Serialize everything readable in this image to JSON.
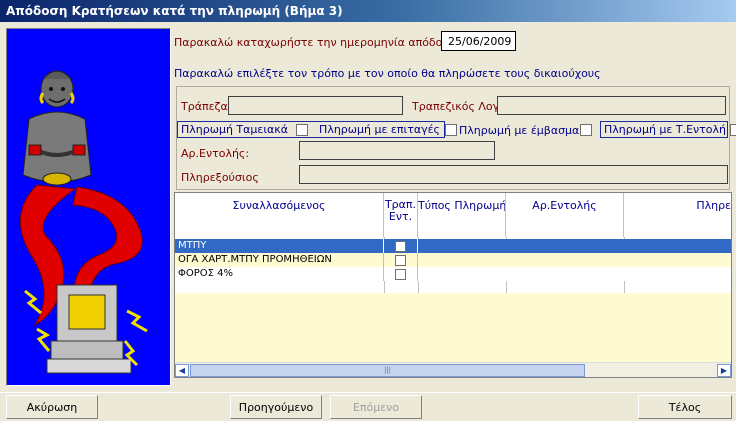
{
  "window": {
    "title": "Απόδοση Κρατήσεων κατά την πληρωμή (Βήμα 3)"
  },
  "form": {
    "date_prompt": "Παρακαλώ καταχωρήστε την ημερομηνία απόδοσης:",
    "date_value": "25/06/2009",
    "method_prompt": "Παρακαλώ επιλέξτε τον τρόπο με τον οποίο θα πληρώσετε τους δικαιούχους",
    "bank_label": "Τράπεζα",
    "bank_value": "",
    "bank_account_label": "Τραπεζικός Λογ.",
    "bank_account_value": "",
    "pay_cash_label": "Πληρωμή Ταμειακά",
    "pay_cheque_label": "Πληρωμή με επιταγές",
    "pay_deposit_label": "Πληρωμή με έμβασμα",
    "pay_order_label": "Πληρωμή με Τ.Εντολή",
    "order_no_label": "Αρ.Εντολής:",
    "order_no_value": "",
    "payer_label": "Πληρεξούσιος",
    "payer_value": ""
  },
  "grid": {
    "columns": [
      "Συναλλασόμενος",
      "Τραπ. Εντ.",
      "Τύπος Πληρωμής",
      "Αρ.Εντολής",
      "Πληρε"
    ],
    "rows": [
      {
        "name": "ΜΤΠΥ",
        "selected": true
      },
      {
        "name": "ΟΓΑ ΧΑΡΤ.ΜΤΠΥ ΠΡΟΜΗΘΕΙΩΝ",
        "selected": false
      },
      {
        "name": "ΦΟΡΟΣ 4%",
        "selected": false
      }
    ],
    "scroll_thumb": "|||"
  },
  "footer": {
    "cancel": "Ακύρωση",
    "previous": "Προηγούμενο",
    "next": "Επόμενο",
    "finish": "Τέλος"
  },
  "colors": {
    "accent": "#0000ff",
    "selection": "#316ac5",
    "label": "#7a0000",
    "navy": "#00008b"
  }
}
